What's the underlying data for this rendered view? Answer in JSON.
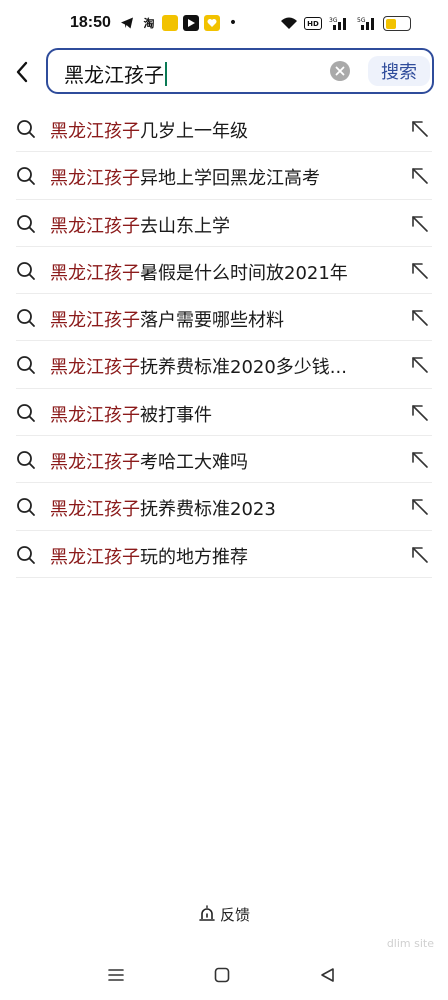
{
  "status_bar": {
    "time": "18:50",
    "icons": [
      "telegram-icon",
      "taobao-icon",
      "app-icon",
      "youtube-icon",
      "heart-app-icon",
      "dot-icon",
      "wifi-icon",
      "hd-icon",
      "signal-icon",
      "signal-icon",
      "battery-icon"
    ],
    "taobao_glyph": "淘",
    "hd_label": "HD",
    "battery_level": 0.45,
    "battery_color": "#f2c200"
  },
  "header": {
    "back_icon": "chevron-left-icon",
    "query": "黑龙江孩子",
    "clear_icon": "clear-icon",
    "search_button_label": "搜索",
    "accent_color": "#2f4c9b"
  },
  "suggestions": [
    {
      "highlight": "黑龙江孩子",
      "rest": "几岁上一年级"
    },
    {
      "highlight": "黑龙江孩子",
      "rest": "异地上学回黑龙江高考"
    },
    {
      "highlight": "黑龙江孩子",
      "rest": "去山东上学"
    },
    {
      "highlight": "黑龙江孩子",
      "rest": "暑假是什么时间放2021年"
    },
    {
      "highlight": "黑龙江孩子",
      "rest": "落户需要哪些材料"
    },
    {
      "highlight": "黑龙江孩子",
      "rest": "抚养费标准2020多少钱..."
    },
    {
      "highlight": "黑龙江孩子",
      "rest": "被打事件"
    },
    {
      "highlight": "黑龙江孩子",
      "rest": "考哈工大难吗"
    },
    {
      "highlight": "黑龙江孩子",
      "rest": "抚养费标准2023"
    },
    {
      "highlight": "黑龙江孩子",
      "rest": "玩的地方推荐"
    }
  ],
  "highlight_color": "#8b1a1a",
  "footer": {
    "feedback_label": "反馈",
    "feedback_icon": "feedback-icon",
    "watermark": "dlim site"
  },
  "nav": {
    "menu_icon": "menu-icon",
    "home_icon": "home-icon",
    "back_icon": "back-triangle-icon"
  }
}
